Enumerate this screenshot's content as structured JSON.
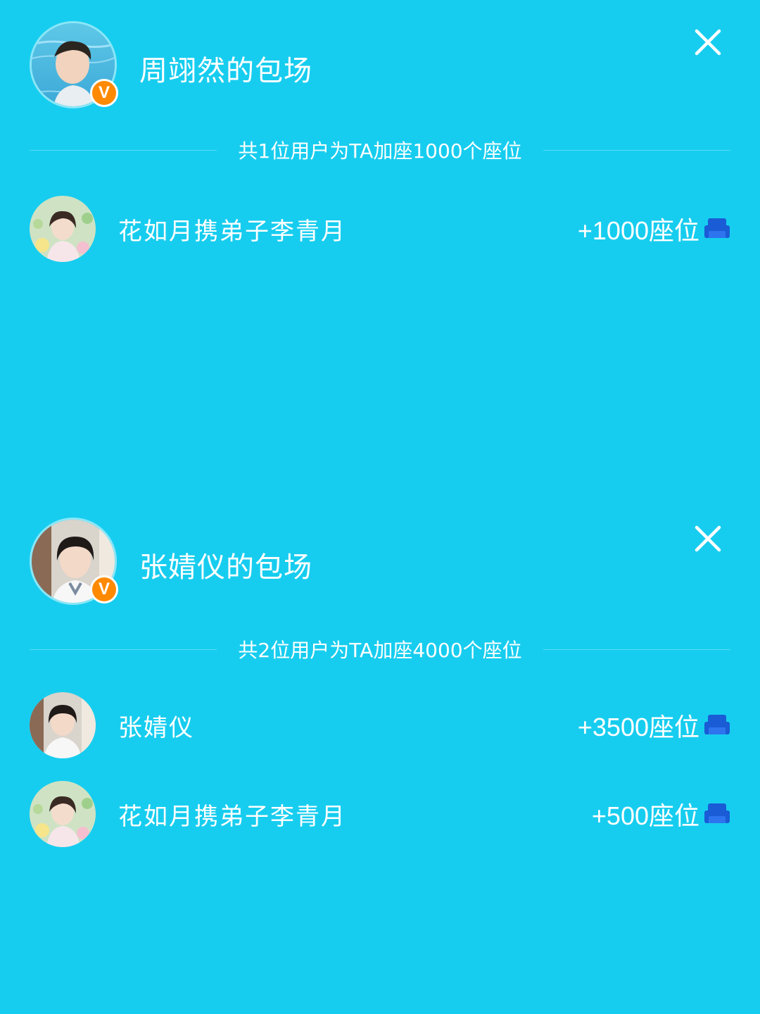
{
  "panels": [
    {
      "title": "周翊然的包场",
      "summary": "共1位用户为TA加座1000个座位",
      "rows": [
        {
          "name": "花如月携弟子李青月",
          "amount": "+1000座位"
        }
      ]
    },
    {
      "title": "张婧仪的包场",
      "summary": "共2位用户为TA加座4000个座位",
      "rows": [
        {
          "name": "张婧仪",
          "amount": "+3500座位"
        },
        {
          "name": "花如月携弟子李青月",
          "amount": "+500座位"
        }
      ]
    }
  ],
  "verified_badge": "V",
  "colors": {
    "background": "#17cdef",
    "badge": "#ff8a00",
    "seat_icon": "#1a5bd6"
  },
  "icons": {
    "close": "close-icon",
    "seat": "seat-icon",
    "verified": "verified-badge"
  }
}
